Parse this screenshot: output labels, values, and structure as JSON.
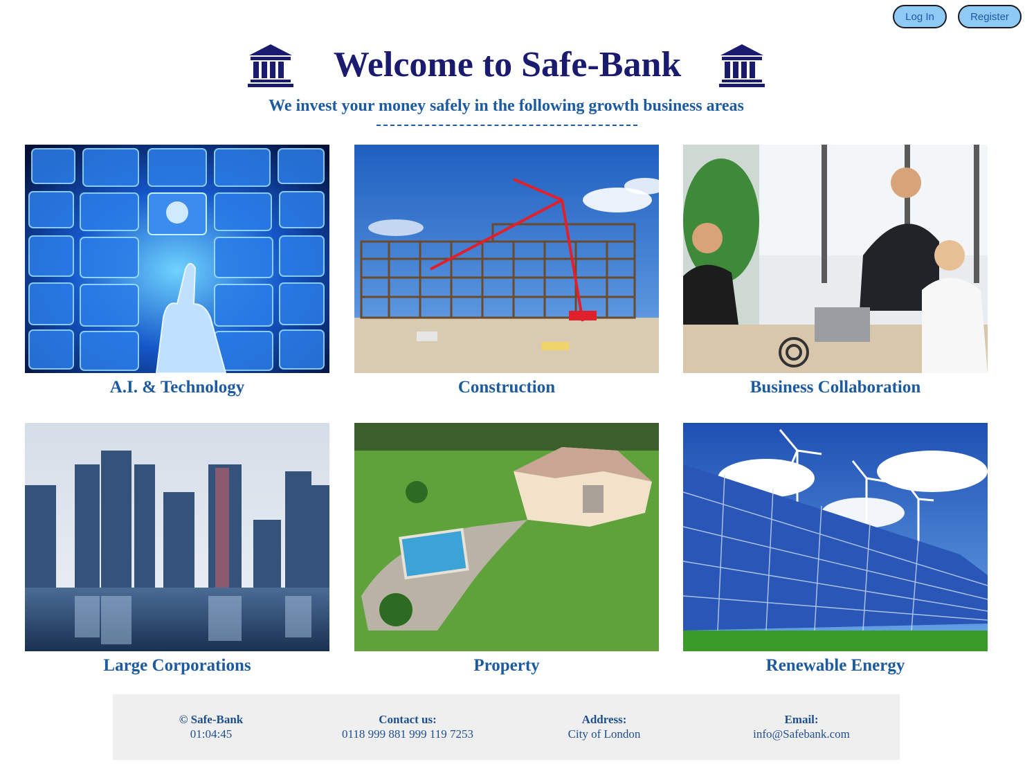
{
  "auth": {
    "login_label": "Log In",
    "register_label": "Register"
  },
  "header": {
    "title": "Welcome to Safe-Bank",
    "subtitle": "We invest your money safely in the following growth business areas",
    "icon": "bank-building-icon"
  },
  "areas": [
    {
      "label": "A.I. & Technology",
      "image": "ai-technology-photo"
    },
    {
      "label": "Construction",
      "image": "construction-site-photo"
    },
    {
      "label": "Business Collaboration",
      "image": "business-meeting-photo"
    },
    {
      "label": "Large Corporations",
      "image": "city-skyline-photo"
    },
    {
      "label": "Property",
      "image": "house-with-pool-photo"
    },
    {
      "label": "Renewable Energy",
      "image": "solar-wind-photo"
    }
  ],
  "footer": {
    "copyright_label": "© Safe-Bank",
    "clock": "01:04:45",
    "contact_label": "Contact us:",
    "contact_value": "0118 999 881 999 119 7253",
    "address_label": "Address:",
    "address_value": "City of London",
    "email_label": "Email:",
    "email_value": "info@Safebank.com"
  },
  "colors": {
    "title": "#1a1a6e",
    "accent": "#1d5ba0",
    "button_bg": "#8ecaf5",
    "footer_bg": "#efefef"
  }
}
